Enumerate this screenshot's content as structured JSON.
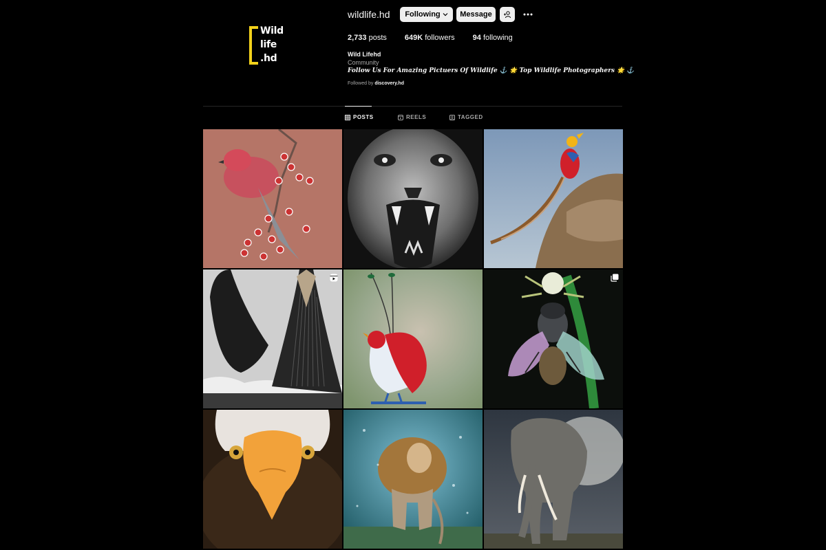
{
  "profile": {
    "username": "wildlife.hd",
    "following_label": "Following",
    "message_label": "Message",
    "stats": {
      "posts": "2,733",
      "posts_label": "posts",
      "followers": "649K",
      "followers_label": "followers",
      "following": "94",
      "following_label": "following"
    },
    "name": "Wild Lifehd",
    "category": "Community",
    "bio": "Follow Us For Amazing Pictuers Of Wildlife ⚓ 🌟 Top Wildlife Photographers 🌟 ⚓",
    "followed_by_prefix": "Followed by",
    "followed_by_user": "discovery.hd",
    "logo_lines": [
      "Wild",
      "life",
      ".hd"
    ]
  },
  "tabs": [
    {
      "label": "POSTS",
      "icon": "grid-icon",
      "active": true
    },
    {
      "label": "REELS",
      "icon": "reels-icon",
      "active": false
    },
    {
      "label": "TAGGED",
      "icon": "tagged-icon",
      "active": false
    }
  ],
  "colors": {
    "accent_yellow": "#f3d21b",
    "button_bg": "#efefef",
    "background": "#000000"
  },
  "posts": [
    {
      "subject": "pine-grosbeak-on-berries",
      "badge": null
    },
    {
      "subject": "roaring-lion-bw",
      "badge": null
    },
    {
      "subject": "golden-pheasant-on-rock",
      "badge": null
    },
    {
      "subject": "humpback-whales-breaching",
      "badge": "reel-icon"
    },
    {
      "subject": "king-bird-of-paradise",
      "badge": null
    },
    {
      "subject": "crab-spider-with-fly",
      "badge": "carousel-icon"
    },
    {
      "subject": "bald-eagle-closeup",
      "badge": null
    },
    {
      "subject": "lion-shaking-water",
      "badge": null
    },
    {
      "subject": "elephant-in-dust",
      "badge": null
    }
  ]
}
